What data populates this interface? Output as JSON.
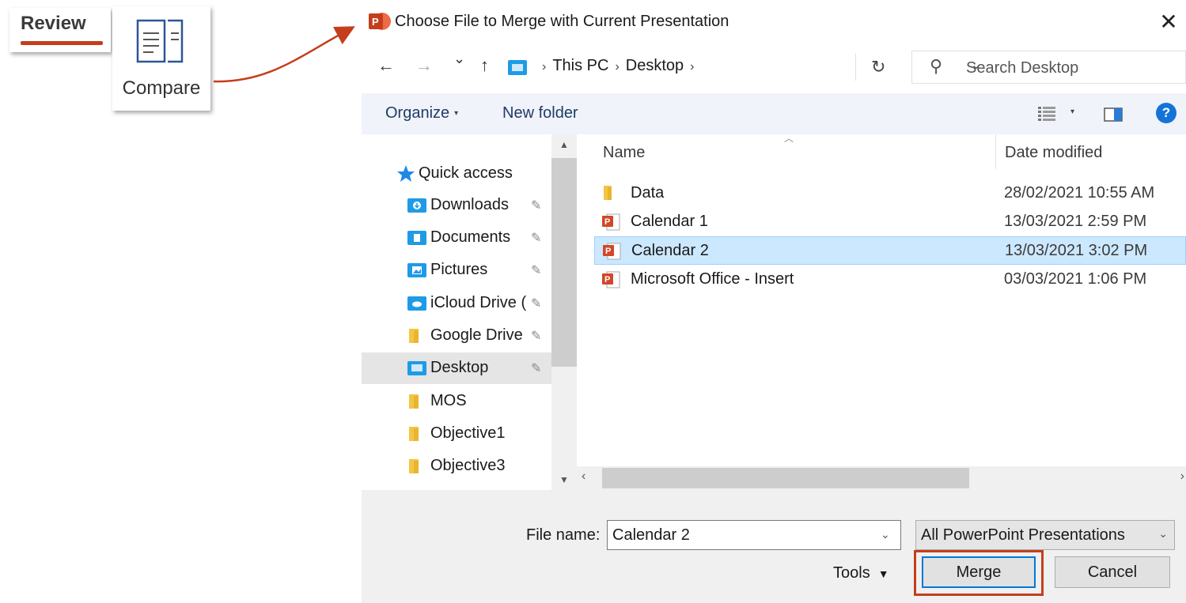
{
  "callout": {
    "review_label": "Review",
    "compare_label": "Compare"
  },
  "dialog": {
    "title": "Choose File to Merge with Current Presentation",
    "close_glyph": "✕",
    "nav": {
      "back": "←",
      "forward": "→",
      "recent": "⌄",
      "up": "↑",
      "refresh": "↻",
      "address_dropdown": "⌄",
      "breadcrumbs": [
        "This PC",
        "Desktop"
      ],
      "breadcrumb_sep": "›"
    },
    "search": {
      "placeholder": "Search Desktop",
      "icon_glyph": "⚲"
    },
    "toolbar": {
      "organize": "Organize",
      "new_folder": "New folder",
      "help": "?"
    },
    "navpane": {
      "items": [
        {
          "label": "Quick access",
          "icon": "star-icon",
          "pinned": false
        },
        {
          "label": "Downloads",
          "icon": "downloads-folder-icon",
          "pinned": true
        },
        {
          "label": "Documents",
          "icon": "documents-folder-icon",
          "pinned": true
        },
        {
          "label": "Pictures",
          "icon": "pictures-folder-icon",
          "pinned": true
        },
        {
          "label": "iCloud Drive (",
          "icon": "icloud-folder-icon",
          "pinned": true
        },
        {
          "label": "Google Drive",
          "icon": "folder-icon",
          "pinned": true
        },
        {
          "label": "Desktop",
          "icon": "desktop-folder-icon",
          "pinned": true,
          "selected": true
        },
        {
          "label": "MOS",
          "icon": "folder-icon",
          "pinned": false
        },
        {
          "label": "Objective1",
          "icon": "folder-icon",
          "pinned": false
        },
        {
          "label": "Objective3",
          "icon": "folder-icon",
          "pinned": false
        }
      ],
      "pin_glyph": "📌"
    },
    "filelist": {
      "columns": {
        "name": "Name",
        "date": "Date modified"
      },
      "files": [
        {
          "name": "Data",
          "date": "28/02/2021 10:55 AM",
          "type": "folder",
          "selected": false
        },
        {
          "name": "Calendar 1",
          "date": "13/03/2021 2:59 PM",
          "type": "pptx",
          "selected": false
        },
        {
          "name": "Calendar 2",
          "date": "13/03/2021 3:02 PM",
          "type": "pptx",
          "selected": true
        },
        {
          "name": "Microsoft Office - Insert",
          "date": "03/03/2021 1:06 PM",
          "type": "pptx",
          "selected": false
        }
      ]
    },
    "bottom": {
      "file_name_label": "File name:",
      "file_name_value": "Calendar 2",
      "file_type": "All PowerPoint Presentations",
      "tools_label": "Tools",
      "merge_label": "Merge",
      "cancel_label": "Cancel"
    }
  },
  "colors": {
    "accent_red": "#c43e1c",
    "selection_blue": "#cce8ff",
    "primary_button_border": "#0078d7",
    "folder_yellow": "#f4c542",
    "folder_blue": "#1e9be6",
    "ppt_red": "#d24726"
  }
}
